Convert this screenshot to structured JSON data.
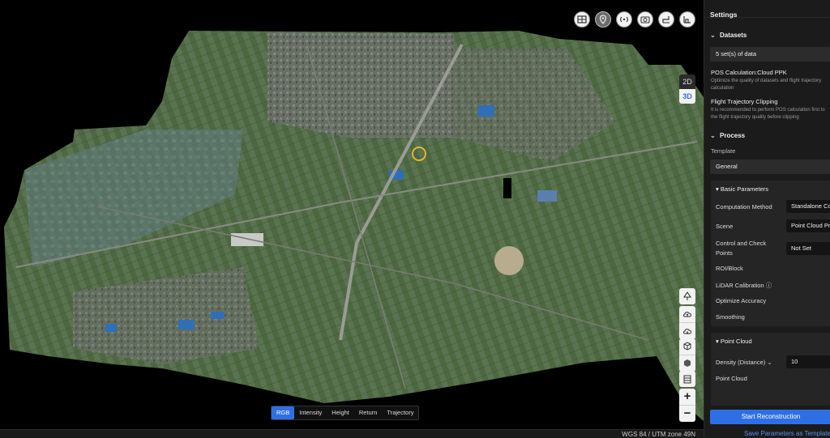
{
  "toolbar": {
    "icons": [
      "map-layers-icon",
      "location-pin-icon",
      "signal-icon",
      "camera-icon",
      "trajectory-icon",
      "terrain-icon"
    ],
    "active": "location-pin-icon"
  },
  "view_toggle": {
    "two_d": "2D",
    "three_d": "3D",
    "selected": "3D"
  },
  "zoom": {
    "in": "+",
    "out": "−"
  },
  "modes": {
    "items": [
      "RGB",
      "Intensity",
      "Height",
      "Return",
      "Trajectory"
    ],
    "selected": "RGB"
  },
  "status": {
    "crs": "WGS 84 / UTM zone 49N"
  },
  "settings": {
    "title": "Settings",
    "datasets": {
      "heading": "Datasets",
      "count": "5 set(s) of data",
      "pos_title": "POS Calculation:Cloud PPK",
      "pos_desc_1": "Optimize the quality of datasets and flight trajectory",
      "pos_desc_2": "calculation",
      "clip_title": "Flight Trajectory Clipping",
      "clip_desc_1": "It is recommended to perform POS calculation first to",
      "clip_desc_2": "the flight trajectory quality before clipping"
    },
    "process": {
      "heading": "Process",
      "template_label": "Template",
      "template_value": "General",
      "basic": {
        "heading": "Basic Parameters",
        "computation_method": {
          "label": "Computation Method",
          "value": "Standalone Computing"
        },
        "scene": {
          "label": "Scene",
          "value": "Point Cloud Processing"
        },
        "control_1": "Control and Check",
        "control_2": "Points",
        "control_value": "Not Set",
        "roi": "ROI/Block",
        "lidar": "LiDAR Calibration",
        "optimize": "Optimize Accuracy",
        "smoothing": "Smoothing"
      },
      "point_cloud": {
        "heading": "Point Cloud",
        "density_label": "Density (Distance)",
        "density_value": "10",
        "next_label": "Point Cloud"
      }
    },
    "start_button": "Start Reconstruction",
    "save_link": "Save Parameters as Template"
  },
  "colors": {
    "accent": "#2f6fe4",
    "panel": "#1b1b1b",
    "field": "#4a6a3a"
  }
}
